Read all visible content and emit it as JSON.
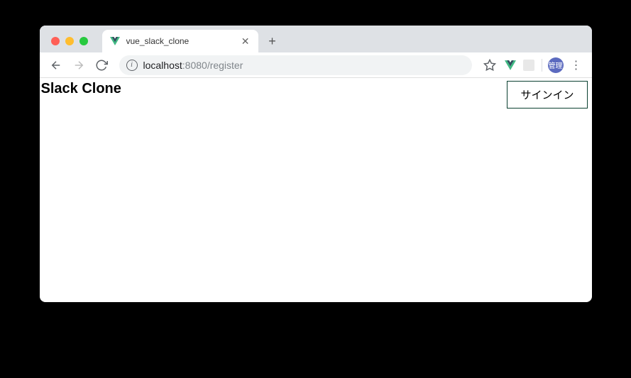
{
  "tab": {
    "title": "vue_slack_clone"
  },
  "address": {
    "host": "localhost",
    "port": ":8080",
    "path": "/register"
  },
  "extensions": {
    "profile_label": "管理"
  },
  "page": {
    "title": "Slack Clone",
    "signin_button": "サインイン"
  }
}
